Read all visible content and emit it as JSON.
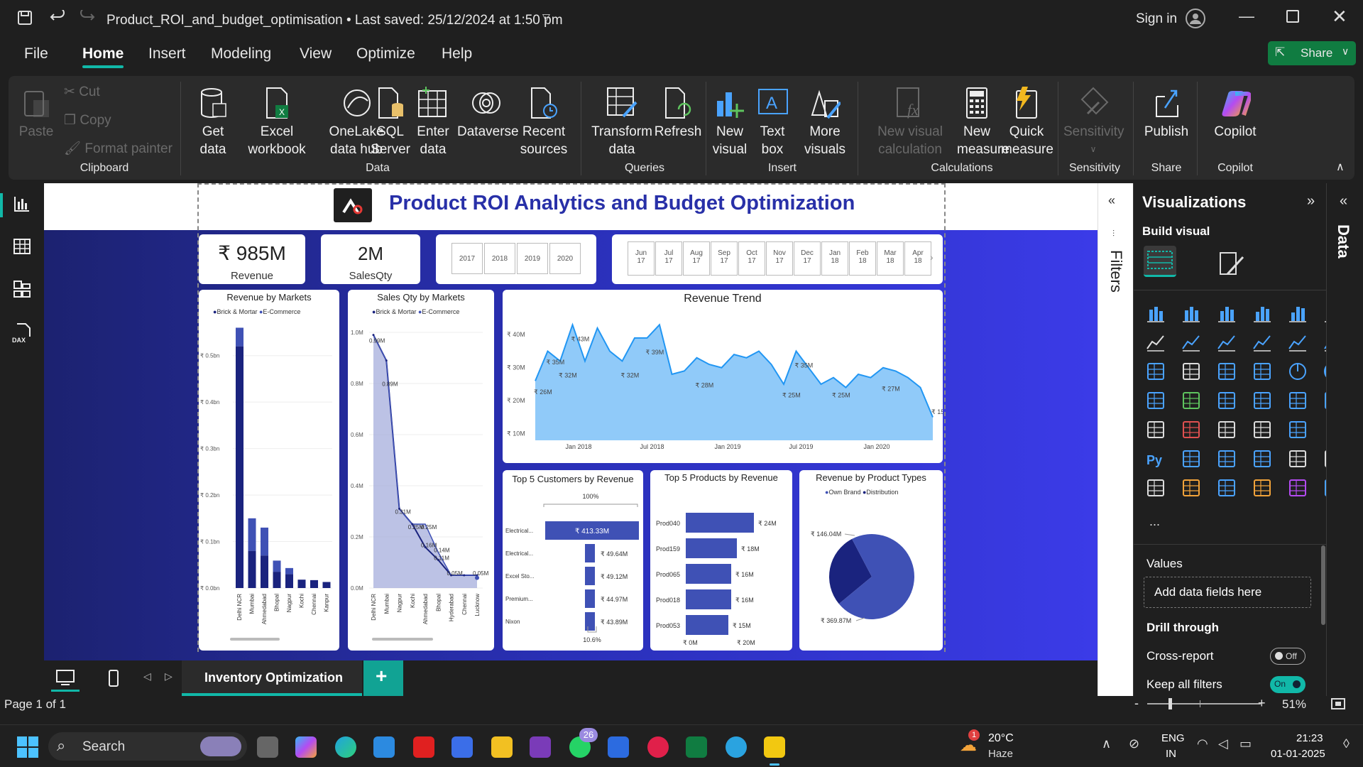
{
  "titlebar": {
    "title": "Product_ROI_and_budget_optimisation • Last saved: 25/12/2024 at 1:50 pm",
    "sign_in": "Sign in"
  },
  "menu": {
    "items": [
      "File",
      "Home",
      "Insert",
      "Modeling",
      "View",
      "Optimize",
      "Help"
    ],
    "share": "Share"
  },
  "ribbon": {
    "clipboard": {
      "paste": "Paste",
      "cut": "Cut",
      "copy": "Copy",
      "format_painter": "Format painter",
      "group": "Clipboard"
    },
    "data": {
      "get_data": "Get data",
      "excel": "Excel workbook",
      "onelake": "OneLake data hub",
      "sql": "SQL Server",
      "enter": "Enter data",
      "dataverse": "Dataverse",
      "recent": "Recent sources",
      "group": "Data"
    },
    "queries": {
      "transform": "Transform data",
      "refresh": "Refresh",
      "group": "Queries"
    },
    "insert": {
      "new_visual": "New visual",
      "text_box": "Text box",
      "more": "More visuals",
      "group": "Insert"
    },
    "calculations": {
      "new_visual_calc": "New visual calculation",
      "new_measure": "New measure",
      "quick_measure": "Quick measure",
      "group": "Calculations"
    },
    "sensitivity": {
      "label": "Sensitivity",
      "group": "Sensitivity"
    },
    "share": {
      "publish": "Publish",
      "group": "Share"
    },
    "copilot": {
      "label": "Copilot",
      "group": "Copilot"
    }
  },
  "report": {
    "title": "Product ROI Analytics and Budget Optimization",
    "kpi_revenue": {
      "value": "₹ 985M",
      "label": "Revenue"
    },
    "kpi_qty": {
      "value": "2M",
      "label": "SalesQty"
    },
    "years": [
      "2017",
      "2018",
      "2019",
      "2020"
    ],
    "months": [
      [
        "Jun",
        "17"
      ],
      [
        "Jul",
        "17"
      ],
      [
        "Aug",
        "17"
      ],
      [
        "Sep",
        "17"
      ],
      [
        "Oct",
        "17"
      ],
      [
        "Nov",
        "17"
      ],
      [
        "Dec",
        "17"
      ],
      [
        "Jan",
        "18"
      ],
      [
        "Feb",
        "18"
      ],
      [
        "Mar",
        "18"
      ],
      [
        "Apr",
        "18"
      ]
    ]
  },
  "chart_data": [
    {
      "type": "bar",
      "title": "Revenue by Markets",
      "legend": [
        "Brick & Mortar",
        "E-Commerce"
      ],
      "categories": [
        "Delhi NCR",
        "Mumbai",
        "Ahmedabad",
        "Bhopal",
        "Nagpur",
        "Kochi",
        "Chennai",
        "Kanpur"
      ],
      "series": [
        {
          "name": "Brick & Mortar",
          "values": [
            0.52,
            0.08,
            0.07,
            0.035,
            0.03,
            0.018,
            0.017,
            0.013
          ]
        },
        {
          "name": "E-Commerce",
          "values": [
            0.04,
            0.07,
            0.06,
            0.024,
            0.013,
            0.0,
            0.0,
            0.0
          ]
        }
      ],
      "yticks": [
        "₹ 0.0bn",
        "₹ 0.1bn",
        "₹ 0.2bn",
        "₹ 0.3bn",
        "₹ 0.4bn",
        "₹ 0.5bn"
      ],
      "ylim": [
        0,
        0.55
      ]
    },
    {
      "type": "area",
      "title": "Sales Qty by Markets",
      "legend": [
        "Brick & Mortar",
        "E-Commerce"
      ],
      "categories": [
        "Delhi NCR",
        "Mumbai",
        "Nagpur",
        "Kochi",
        "Ahmedabad",
        "Bhopal",
        "Hyderabad",
        "Chennai",
        "Lucknow"
      ],
      "series": [
        {
          "name": "Brick & Mortar",
          "values": [
            0.99,
            0.89,
            0.31,
            0.25,
            0.16,
            0.11,
            0.05,
            0.05,
            0.05
          ]
        },
        {
          "name": "E-Commerce",
          "values": [
            0.99,
            0.89,
            0.31,
            0.25,
            0.25,
            0.14,
            0.05,
            0.05,
            0.05
          ]
        }
      ],
      "labels": [
        "0.99M",
        "0.89M",
        "0.31M",
        "0.25M",
        "0.16M",
        "0.11M",
        "0.25M",
        "0.14M",
        "0.05M",
        "0.05M"
      ],
      "yticks": [
        "0.0M",
        "0.2M",
        "0.4M",
        "0.6M",
        "0.8M",
        "1.0M"
      ],
      "ylim": [
        0,
        1.0
      ]
    },
    {
      "type": "area",
      "title": "Revenue Trend",
      "x": [
        "Oct 2017",
        "Nov 2017",
        "Dec 2017",
        "Jan 2018",
        "Feb 2018",
        "Mar 2018",
        "Apr 2018",
        "May 2018",
        "Jun 2018",
        "Jul 2018",
        "Aug 2018",
        "Sep 2018",
        "Oct 2018",
        "Nov 2018",
        "Dec 2018",
        "Jan 2019",
        "Feb 2019",
        "Mar 2019",
        "Apr 2019",
        "May 2019",
        "Jun 2019",
        "Jul 2019",
        "Aug 2019",
        "Sep 2019",
        "Oct 2019",
        "Nov 2019",
        "Dec 2019",
        "Jan 2020",
        "Feb 2020",
        "Mar 2020",
        "Apr 2020",
        "May 2020",
        "Jun 2020"
      ],
      "values": [
        26,
        35,
        32,
        43,
        32,
        42,
        35,
        32,
        39,
        39,
        43,
        28,
        29,
        33,
        31,
        30,
        34,
        33,
        35,
        31,
        25,
        35,
        30,
        25,
        27,
        24,
        28,
        27,
        30,
        29,
        27,
        24,
        15
      ],
      "data_labels": [
        "₹ 35M",
        "₹ 26M",
        "₹ 32M",
        "₹ 43M",
        "₹ 32M",
        "₹ 39M",
        "₹ 28M",
        "₹ 35M",
        "₹ 25M",
        "₹ 25M",
        "₹ 27M",
        "₹ 15M"
      ],
      "xticks": [
        "Jan 2018",
        "Jul 2018",
        "Jan 2019",
        "Jul 2019",
        "Jan 2020"
      ],
      "yticks": [
        "₹ 10M",
        "₹ 20M",
        "₹ 30M",
        "₹ 40M"
      ],
      "ylim": [
        8,
        45
      ]
    },
    {
      "type": "bar",
      "title": "Top 5 Customers by Revenue",
      "categories": [
        "Electrical...",
        "Electrical...",
        "Excel Sto...",
        "Premium...",
        "Nixon"
      ],
      "values": [
        413.33,
        49.64,
        49.12,
        44.97,
        43.89
      ],
      "labels": [
        "₹ 413.33M",
        "₹ 49.64M",
        "₹ 49.12M",
        "₹ 44.97M",
        "₹ 43.89M"
      ],
      "top_pct": "100%",
      "bottom_pct": "10.6%"
    },
    {
      "type": "bar",
      "title": "Top 5 Products by Revenue",
      "categories": [
        "Prod040",
        "Prod159",
        "Prod065",
        "Prod018",
        "Prod053"
      ],
      "values": [
        24,
        18,
        16,
        16,
        15
      ],
      "labels": [
        "₹ 24M",
        "₹ 18M",
        "₹ 16M",
        "₹ 16M",
        "₹ 15M"
      ],
      "xticks": [
        "₹ 0M",
        "₹ 20M"
      ],
      "xlim": [
        0,
        30
      ]
    },
    {
      "type": "pie",
      "title": "Revenue by Product Types",
      "legend": [
        "Own Brand",
        "Distribution"
      ],
      "values": [
        146.04,
        369.87
      ],
      "labels": [
        "₹ 146.04M",
        "₹ 369.87M"
      ]
    }
  ],
  "filters_label": "Filters",
  "viz": {
    "title": "Visualizations",
    "build": "Build visual",
    "values": "Values",
    "add_fields": "Add data fields here",
    "drill": "Drill through",
    "cross": "Cross-report",
    "cross_state": "Off",
    "keep": "Keep all filters",
    "keep_state": "On",
    "more": "..."
  },
  "data_label": "Data",
  "tab": {
    "name": "Inventory Optimization"
  },
  "status": {
    "page": "Page 1 of 1",
    "zoom": "51%"
  },
  "taskbar": {
    "search": "Search",
    "weather_temp": "20°C",
    "weather_desc": "Haze",
    "lang1": "ENG",
    "lang2": "IN",
    "time": "21:23",
    "date": "01-01-2025",
    "badge_wa": "26",
    "badge_weather": "1"
  },
  "colors": {
    "accent": "#11b8a8",
    "dark_blue": "#1a237e",
    "bar_light": "#3f51b5",
    "area": "#90caf9",
    "line": "#2196f3"
  }
}
